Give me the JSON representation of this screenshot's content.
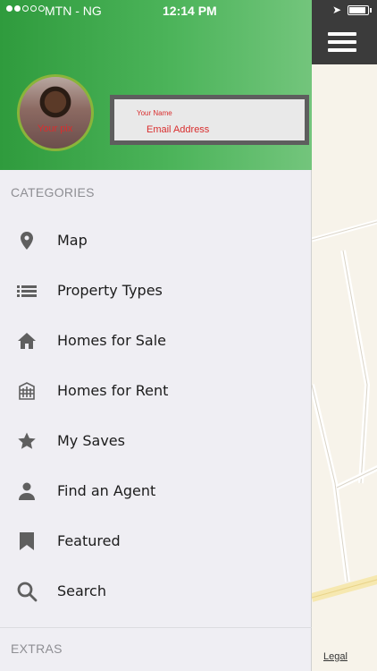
{
  "status_bar": {
    "carrier": "MTN - NG",
    "time": "12:14 PM"
  },
  "profile": {
    "avatar_caption": "Your pix",
    "name_label": "Your Name",
    "email_label": "Email Address"
  },
  "drawer": {
    "categories_title": "CATEGORIES",
    "items": [
      {
        "label": "Map",
        "icon": "map-pin-icon"
      },
      {
        "label": "Property Types",
        "icon": "list-icon"
      },
      {
        "label": "Homes for Sale",
        "icon": "home-icon"
      },
      {
        "label": "Homes for Rent",
        "icon": "building-icon"
      },
      {
        "label": "My Saves",
        "icon": "star-icon"
      },
      {
        "label": "Find an Agent",
        "icon": "person-icon"
      },
      {
        "label": "Featured",
        "icon": "bookmark-icon"
      },
      {
        "label": "Search",
        "icon": "search-icon"
      }
    ],
    "extras_title": "EXTRAS"
  },
  "map": {
    "legal_label": "Legal"
  },
  "colors": {
    "header_green": "#3aa548",
    "accent_red": "#d92e2e",
    "icon_gray": "#5f5f5f"
  }
}
